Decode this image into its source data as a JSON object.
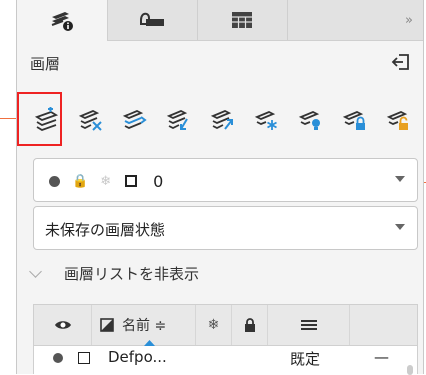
{
  "tabs": [
    {
      "name": "layer-properties-tab",
      "icon": "layers-info-icon",
      "active": true
    },
    {
      "name": "block-tab",
      "icon": "block-icon",
      "active": false
    },
    {
      "name": "table-tab",
      "icon": "table-icon",
      "active": false
    }
  ],
  "tab_more_label": "»",
  "panel": {
    "title": "画層"
  },
  "toolbar": {
    "icons": [
      "new-layer-icon",
      "delete-layer-icon",
      "set-current-layer-icon",
      "isolate-layer-icon",
      "unisolate-layer-icon",
      "freeze-layer-icon",
      "layer-off-icon",
      "lock-layer-icon",
      "unlock-layer-icon"
    ]
  },
  "current_layer": {
    "name": "0"
  },
  "layer_state": {
    "value": "未保存の画層状態"
  },
  "list_toggle": {
    "label": "画層リストを非表示"
  },
  "table": {
    "headers": {
      "name": "名前 ≑"
    },
    "rows": [
      {
        "name": "Defpo...",
        "linetype": "既定",
        "lineweight": "—"
      }
    ]
  },
  "colors": {
    "accent": "#2a8fd8",
    "highlight": "#e22222",
    "callout": "#f07040"
  }
}
